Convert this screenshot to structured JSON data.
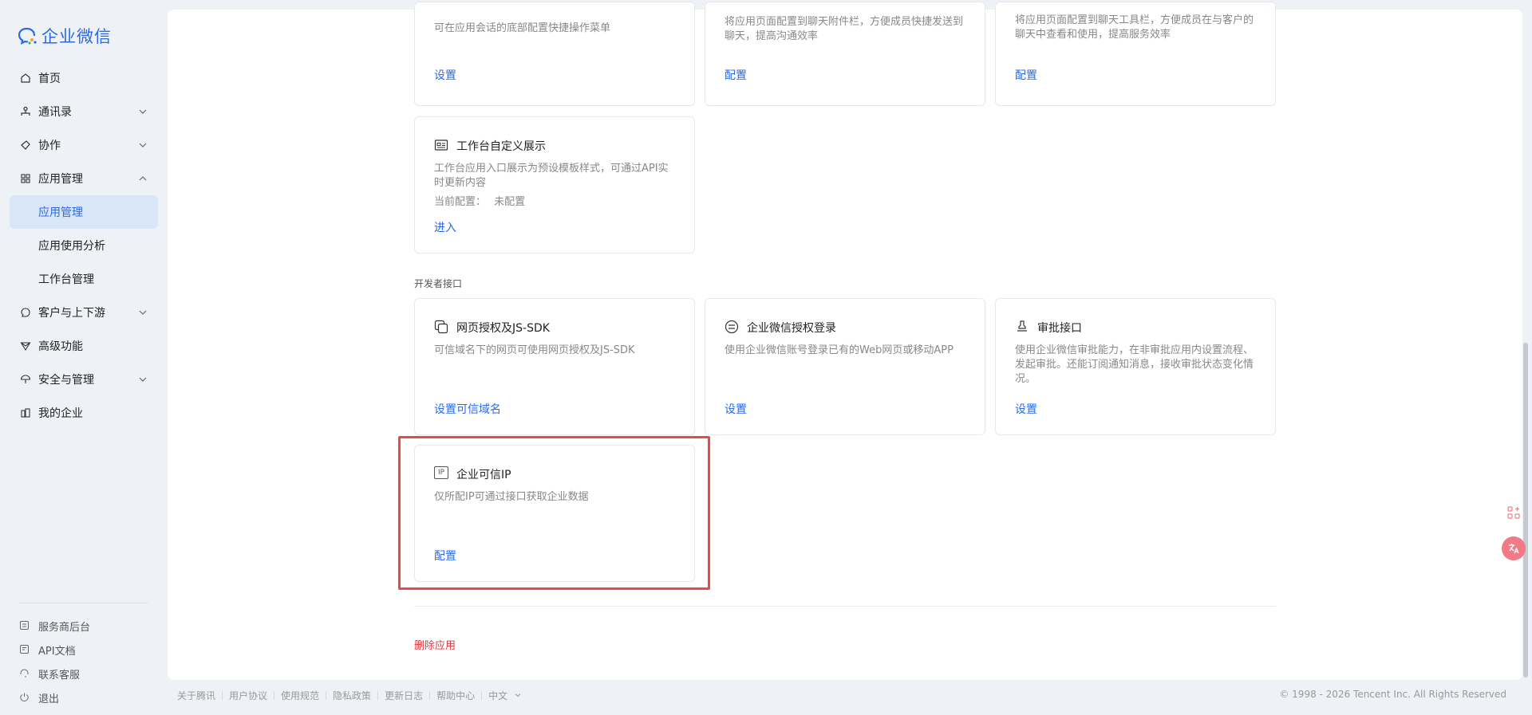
{
  "app": {
    "logo_text": "企业微信"
  },
  "nav": {
    "home": "首页",
    "contacts": "通讯录",
    "collab": "协作",
    "app_mgmt": "应用管理",
    "app_mgmt_sub": "应用管理",
    "app_usage": "应用使用分析",
    "workbench": "工作台管理",
    "customers": "客户与上下游",
    "advanced": "高级功能",
    "security": "安全与管理",
    "my_company": "我的企业"
  },
  "side_bottom": {
    "service_backend": "服务商后台",
    "api_docs": "API文档",
    "contact_support": "联系客服",
    "logout": "退出"
  },
  "top_cards": [
    {
      "desc": "可在应用会话的底部配置快捷操作菜单",
      "link": "设置"
    },
    {
      "desc": "将应用页面配置到聊天附件栏，方便成员快捷发送到聊天，提高沟通效率",
      "link": "配置"
    },
    {
      "desc": "将应用页面配置到聊天工具栏，方便成员在与客户的聊天中查看和使用，提高服务效率",
      "link": "配置"
    }
  ],
  "workbench_card": {
    "title": "工作台自定义展示",
    "desc": "工作台应用入口展示为预设模板样式，可通过API实时更新内容",
    "current_config_label": "当前配置：",
    "current_config_value": "未配置",
    "link": "进入"
  },
  "dev_section_label": "开发者接口",
  "dev_cards": [
    {
      "title": "网页授权及JS-SDK",
      "desc": "可信域名下的网页可使用网页授权及JS-SDK",
      "link": "设置可信域名"
    },
    {
      "title": "企业微信授权登录",
      "desc": "使用企业微信账号登录已有的Web网页或移动APP",
      "link": "设置"
    },
    {
      "title": "审批接口",
      "desc": "使用企业微信审批能力，在非审批应用内设置流程、发起审批。还能订阅通知消息，接收审批状态变化情况。",
      "link": "设置"
    }
  ],
  "trusted_ip_card": {
    "icon_text": "IP",
    "title": "企业可信IP",
    "desc": "仅所配IP可通过接口获取企业数据",
    "link": "配置"
  },
  "delete_app": "删除应用",
  "footer": {
    "links": [
      "关于腾讯",
      "用户协议",
      "使用规范",
      "隐私政策",
      "更新日志",
      "帮助中心"
    ],
    "lang": "中文",
    "copyright": "© 1998 - 2026 Tencent Inc. All Rights Reserved"
  },
  "colors": {
    "accent": "#2a6ae9",
    "highlight": "#e84a4a",
    "danger": "#e0393e"
  }
}
